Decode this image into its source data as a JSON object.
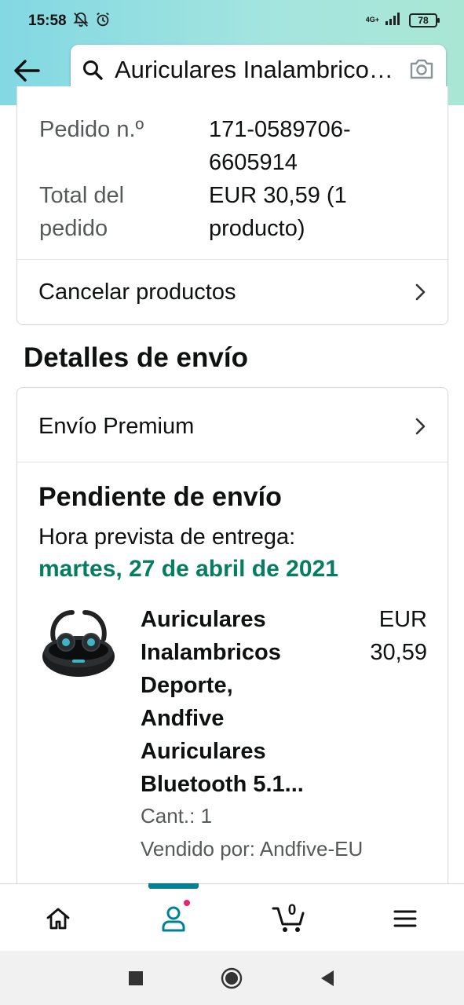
{
  "status_bar": {
    "time": "15:58",
    "network": "4G+",
    "battery": "78",
    "icons": [
      "notifications-off-icon",
      "alarm-icon",
      "signal-icon",
      "battery-icon"
    ]
  },
  "header": {
    "back_icon": "arrow-left-icon",
    "search_query": "Auriculares Inalambricos Deporte",
    "search_icon": "search-icon",
    "camera_icon": "camera-icon"
  },
  "order_summary": {
    "order_number_label": "Pedido n.º",
    "order_number_value_line1": "171-0589706-",
    "order_number_value_line2": "6605914",
    "order_total_label_line1": "Total del",
    "order_total_label_line2": "pedido",
    "order_total_value_line1": "EUR 30,59 (1",
    "order_total_value_line2": "producto)",
    "cancel_label": "Cancelar productos"
  },
  "shipping": {
    "section_title": "Detalles de envío",
    "method_label": "Envío Premium",
    "status_title": "Pendiente de envío",
    "eta_label": "Hora prevista de entrega:",
    "eta_date": "martes, 27 de abril de 2021",
    "accent_color": "#067d62"
  },
  "product": {
    "title_lines": [
      "Auriculares",
      "Inalambricos",
      "Deporte,",
      "Andfive",
      "Auriculares",
      "Bluetooth 5.1..."
    ],
    "price_line1": "EUR",
    "price_line2": "30,59",
    "quantity": "Cant.: 1",
    "seller": "Vendido por: Andfive-EU"
  },
  "bottom_nav": {
    "items": [
      "home-icon",
      "account-icon",
      "cart-icon",
      "menu-icon"
    ],
    "cart_count": "0",
    "active": "account-icon",
    "active_color": "#008296",
    "notification_color": "#e3266d"
  },
  "system_nav": {
    "items": [
      "recents-icon",
      "home-button-icon",
      "back-triangle-icon"
    ]
  }
}
